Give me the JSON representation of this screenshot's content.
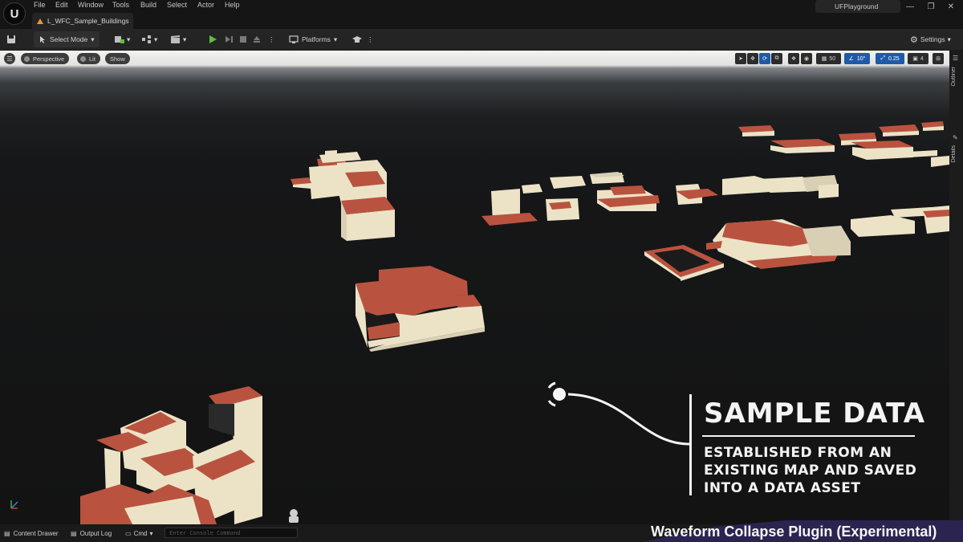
{
  "menu": {
    "items": [
      "File",
      "Edit",
      "Window",
      "Tools",
      "Build",
      "Select",
      "Actor",
      "Help"
    ]
  },
  "tab": {
    "label": "L_WFC_Sample_Buildings"
  },
  "window": {
    "project": "UFPlayground"
  },
  "toolbar": {
    "select_mode": "Select Mode",
    "platforms": "Platforms",
    "settings": "Settings"
  },
  "viewport": {
    "perspective": "Perspective",
    "lit": "Lit",
    "show": "Show",
    "grid_snap": "50",
    "rotation_snap": "10°",
    "scale_snap": "0.25",
    "camera_speed": "4"
  },
  "side_panel": {
    "outliner": "Outliner",
    "details": "Details"
  },
  "bottom": {
    "content_drawer": "Content Drawer",
    "output_log": "Output Log",
    "cmd": "Cmd",
    "console_placeholder": "Enter Console Command"
  },
  "overlay": {
    "title": "SAMPLE DATA",
    "line1": "ESTABLISHED FROM AN",
    "line2": "EXISTING MAP AND SAVED",
    "line3": "INTO A DATA ASSET",
    "footer": "Waveform Collapse Plugin (Experimental)"
  },
  "colors": {
    "roof": "#b9533f",
    "wall": "#ece3c7",
    "accent_blue": "#1e5aa8",
    "play_green": "#5cbf3a"
  }
}
